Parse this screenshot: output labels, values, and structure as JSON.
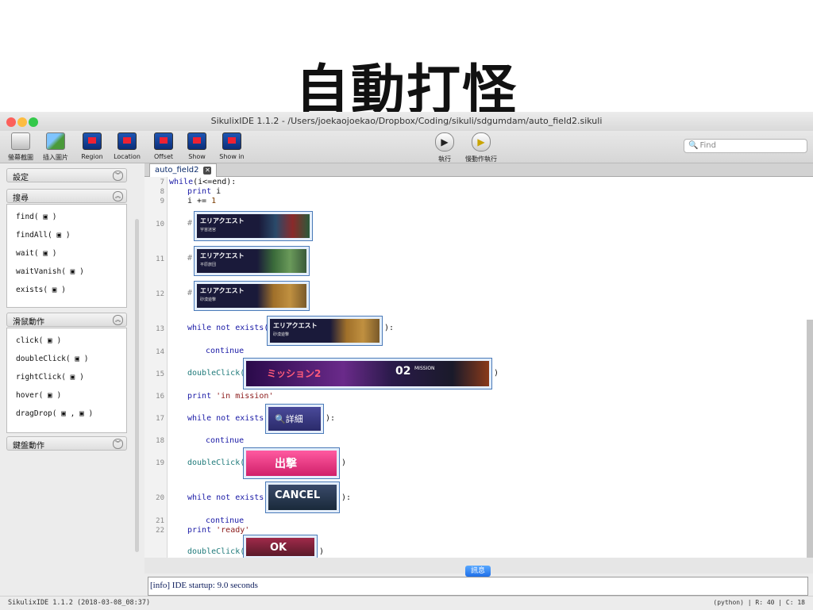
{
  "slide": {
    "title": "自動打怪"
  },
  "window": {
    "title": "SikulixIDE 1.1.2 - /Users/joekaojoekao/Dropbox/Coding/sikuli/sdgumdam/auto_field2.sikuli",
    "traffic_lights": {
      "close": "#fc605b",
      "minimize": "#fdbc40",
      "zoom": "#34c84a"
    }
  },
  "toolbar": {
    "screenshot_label": "螢幕截圖",
    "insert_image_label": "插入圖片",
    "region_label": "Region",
    "location_label": "Location",
    "offset_label": "Offset",
    "show_label": "Show",
    "show_in_label": "Show in",
    "run_label": "執行",
    "run_slow_label": "慢動作執行",
    "find_placeholder": "Find"
  },
  "sidebar": {
    "settings": {
      "title": "設定"
    },
    "find": {
      "title": "搜尋",
      "items": [
        "find( ▣ )",
        "findAll( ▣ )",
        "wait( ▣ )",
        "waitVanish( ▣ )",
        "exists( ▣ )"
      ]
    },
    "mouse": {
      "title": "滑鼠動作",
      "items": [
        "click( ▣ )",
        "doubleClick( ▣ )",
        "rightClick( ▣ )",
        "hover( ▣ )",
        "dragDrop( ▣ , ▣ )"
      ]
    },
    "keyboard": {
      "title": "鍵盤動作"
    }
  },
  "editor": {
    "tab_label": "auto_field2",
    "tab_close": "✕",
    "lines": {
      "l7": "7",
      "l8": "8",
      "l9": "9",
      "l10": "10",
      "l11": "11",
      "l12": "12",
      "l13": "13",
      "l14": "14",
      "l15": "15",
      "l16": "16",
      "l17": "17",
      "l18": "18",
      "l19": "19",
      "l20": "20",
      "l21": "21",
      "l22": "22"
    },
    "code": {
      "while_kw": "while",
      "while_cond": "(i<=end):",
      "print_kw": "print",
      "print_i": " i",
      "inc_var": "i += ",
      "inc_num": "1",
      "hash": "#",
      "while_not_exists": "while not exists(",
      "colon_end": "):",
      "continue": "continue",
      "double_click": "doubleClick(",
      "close_paren": ")",
      "str_in_mission": "'in mission'",
      "str_ready": "'ready'"
    },
    "patterns": {
      "quest_title": "エリアクエスト",
      "quest_sub1": "宇宙迷宮",
      "quest_sub2": "平原旅団",
      "quest_sub3": "砂漠遊撃",
      "mission_text": "ミッション2",
      "mission_code": "02",
      "mission_small": "MISSION",
      "detail_text": "🔍詳細",
      "sortie_text": "出撃",
      "cancel_text": "CANCEL",
      "ok_text": "OK"
    }
  },
  "messages": {
    "button_label": "訊息",
    "console_text": "[info] IDE startup: 9.0 seconds"
  },
  "status": {
    "left": "SikulixIDE 1.1.2 (2018-03-08_08:37)",
    "right": "(python) | R: 40 | C: 18"
  }
}
